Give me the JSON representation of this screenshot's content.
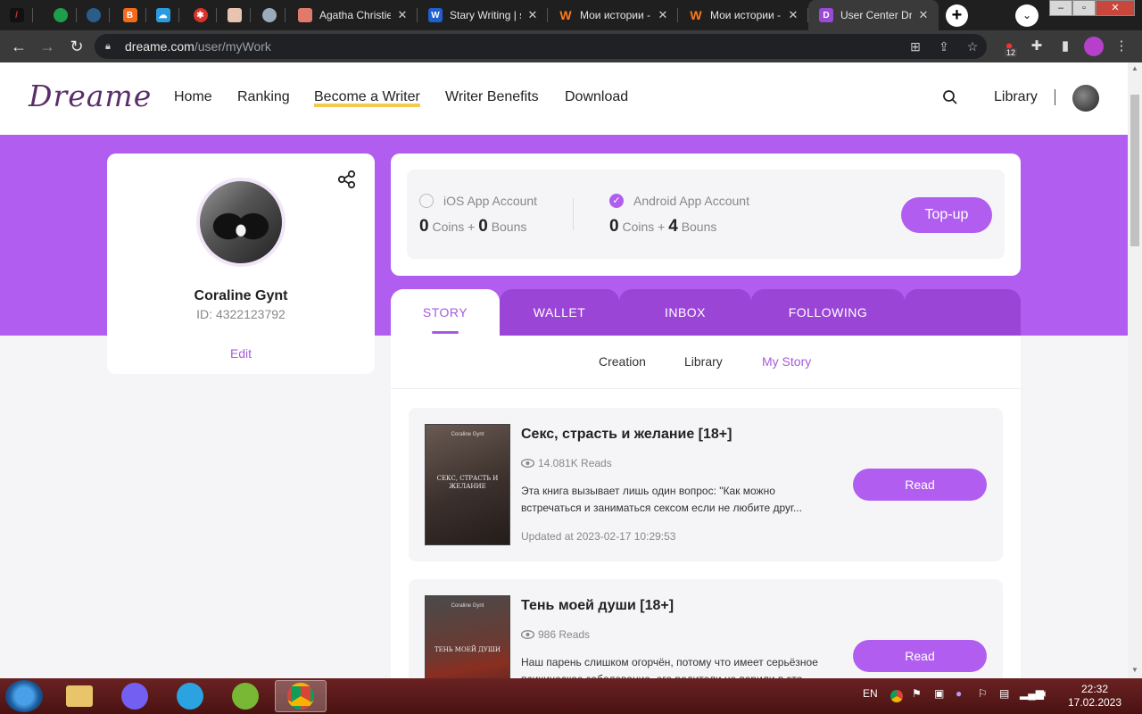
{
  "browser": {
    "tabs": [
      {
        "title": "Agatha Christie"
      },
      {
        "title": "Stary Writing | s"
      },
      {
        "title": "Мои истории -"
      },
      {
        "title": "Мои истории -"
      },
      {
        "title": "User Center Dre"
      }
    ],
    "url_host": "dreame.com",
    "url_path": "/user/myWork",
    "ext_badge": "12"
  },
  "site": {
    "logo": "Dreame",
    "nav": [
      "Home",
      "Ranking",
      "Become a Writer",
      "Writer Benefits",
      "Download"
    ],
    "library": "Library"
  },
  "profile": {
    "name": "Coraline Gynt",
    "id": "ID: 4322123792",
    "edit": "Edit"
  },
  "wallet": {
    "ios_label": "iOS App Account",
    "ios_coins": "0",
    "ios_bonus": "0",
    "android_label": "Android App Account",
    "android_coins": "0",
    "android_bonus": "4",
    "coins_word": "Coins +",
    "bonus_word": "Bouns",
    "topup": "Top-up"
  },
  "tabs": [
    "STORY",
    "WALLET",
    "INBOX",
    "FOLLOWING"
  ],
  "subtabs": [
    "Creation",
    "Library",
    "My Story"
  ],
  "stories": [
    {
      "title": "Секс, страсть и желание [18+]",
      "reads": "14.081K Reads",
      "description": "Эта книга вызывает лишь один вопрос: \"Как можно встречаться и заниматься сексом если не любите друг...",
      "updated": "Updated at 2023-02-17 10:29:53",
      "read": "Read",
      "cover_author": "Coraline Gynt",
      "cover_title": "СЕКС, СТРАСТЬ И ЖЕЛАНИЕ"
    },
    {
      "title": "Тень моей души [18+]",
      "reads": "986 Reads",
      "description": "Наш парень слишком огорчён, потому что имеет серьёзное психическое заболевание, его родители не верили в это...",
      "read": "Read",
      "cover_author": "Coraline Gynt",
      "cover_title": "ТЕНЬ МОЕЙ ДУШИ"
    }
  ],
  "taskbar": {
    "lang": "EN",
    "time": "22:32",
    "date": "17.02.2023"
  },
  "colors": {
    "accent": "#b15ef0",
    "tab_inactive": "#9a45d6",
    "link": "#a55be0"
  }
}
